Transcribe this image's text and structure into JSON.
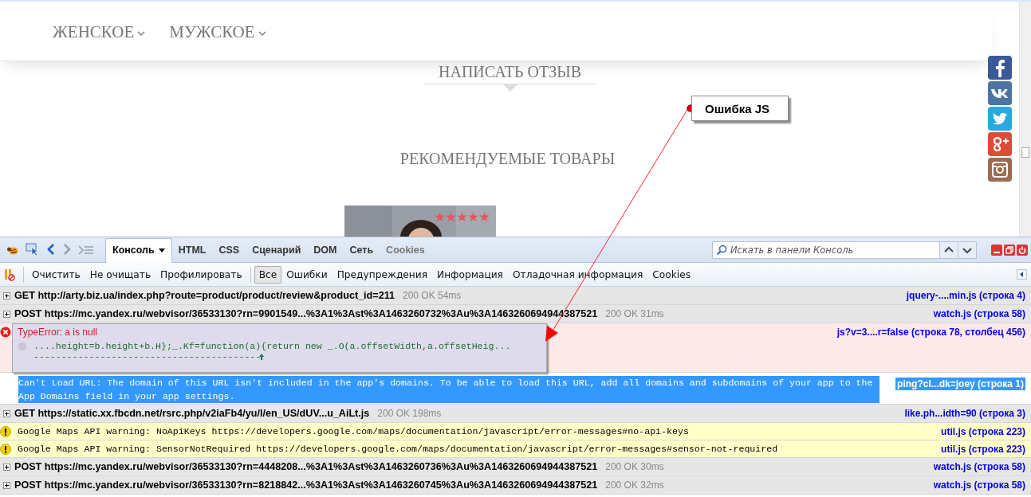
{
  "site": {
    "nav": [
      {
        "label": "ЖЕНСКОЕ"
      },
      {
        "label": "МУЖСКОЕ"
      }
    ],
    "review_link": "НАПИСАТЬ ОТЗЫВ",
    "recommended_title": "РЕКОМЕНДУЕМЫЕ ТОВАРЫ",
    "product": {
      "kind": "picture",
      "stars": 5
    }
  },
  "annotation": {
    "label": "Ошибка JS"
  },
  "devtools": {
    "tabs": [
      {
        "label": "Консоль",
        "selected": true,
        "disabled": false,
        "dropdown": true
      },
      {
        "label": "HTML",
        "selected": false,
        "disabled": false,
        "dropdown": false
      },
      {
        "label": "CSS",
        "selected": false,
        "disabled": false,
        "dropdown": false
      },
      {
        "label": "Сценарий",
        "selected": false,
        "disabled": false,
        "dropdown": false
      },
      {
        "label": "DOM",
        "selected": false,
        "disabled": false,
        "dropdown": false
      },
      {
        "label": "Сеть",
        "selected": false,
        "disabled": false,
        "dropdown": false
      },
      {
        "label": "Cookies",
        "selected": false,
        "disabled": true,
        "dropdown": false
      }
    ],
    "search": {
      "placeholder": "Искать в панели Консоль"
    },
    "actions": [
      "Очистить",
      "Не очищать",
      "Профилировать"
    ],
    "filters": [
      {
        "label": "Все",
        "selected": true
      },
      {
        "label": "Ошибки",
        "selected": false
      },
      {
        "label": "Предупреждения",
        "selected": false
      },
      {
        "label": "Информация",
        "selected": false
      },
      {
        "label": "Отладочная информация",
        "selected": false
      },
      {
        "label": "Cookies",
        "selected": false
      }
    ],
    "log": [
      {
        "kind": "request",
        "text": "GET http://arty.biz.ua/index.php?route=product/product/review&product_id=211",
        "status": "200 OK 54ms",
        "source": "jquery-....min.js (строка 4)",
        "selected": false
      },
      {
        "kind": "request",
        "text": "POST https://mc.yandex.ru/webvisor/36533130?rn=9901549...%3A1%3Ast%3A1463260732%3Au%3A1463260694944387521",
        "status": "200 OK 31ms",
        "source": "watch.js (строка 58)",
        "selected": false
      },
      {
        "kind": "error",
        "text": "TypeError: a is null",
        "code": "....height=b.height+b.H};_.Kf=function(a){return new _.O(a.offsetWidth,a.offsetHeig...",
        "marker": "-----------------------------------------",
        "source": "js?v=3....r=false (строка 78, столбец 456)",
        "selected": false
      },
      {
        "kind": "message",
        "text": "Can't Load URL: The domain of this URL isn't included in the app's domains. To be able to load this URL, add all domains and subdomains of your app to the App Domains field in your app settings.",
        "source": "ping?cl...dk=joey (строка 1)",
        "selected": true
      },
      {
        "kind": "request",
        "text": "GET https://static.xx.fbcdn.net/rsrc.php/v2iaFb4/yu/l/en_US/dUV...u_AiLt.js",
        "status": "200 OK 198ms",
        "source": "like.ph...idth=90 (строка 3)",
        "selected": false
      },
      {
        "kind": "warning",
        "text": "Google Maps API warning: NoApiKeys https://developers.google.com/maps/documentation/javascript/error-messages#no-api-keys",
        "source": "util.js (строка 223)",
        "selected": false
      },
      {
        "kind": "warning",
        "text": "Google Maps API warning: SensorNotRequired https://developers.google.com/maps/documentation/javascript/error-messages#sensor-not-required",
        "source": "util.js (строка 223)",
        "selected": false
      },
      {
        "kind": "request",
        "text": "POST https://mc.yandex.ru/webvisor/36533130?rn=4448208...%3A1%3Ast%3A1463260736%3Au%3A1463260694944387521",
        "status": "200 OK 30ms",
        "source": "watch.js (строка 58)",
        "selected": false
      },
      {
        "kind": "request",
        "text": "POST https://mc.yandex.ru/webvisor/36533130?rn=8218842...%3A1%3Ast%3A1463260745%3Au%3A1463260694944387521",
        "status": "200 OK 32ms",
        "source": "watch.js (строка 58)",
        "selected": false
      }
    ]
  }
}
